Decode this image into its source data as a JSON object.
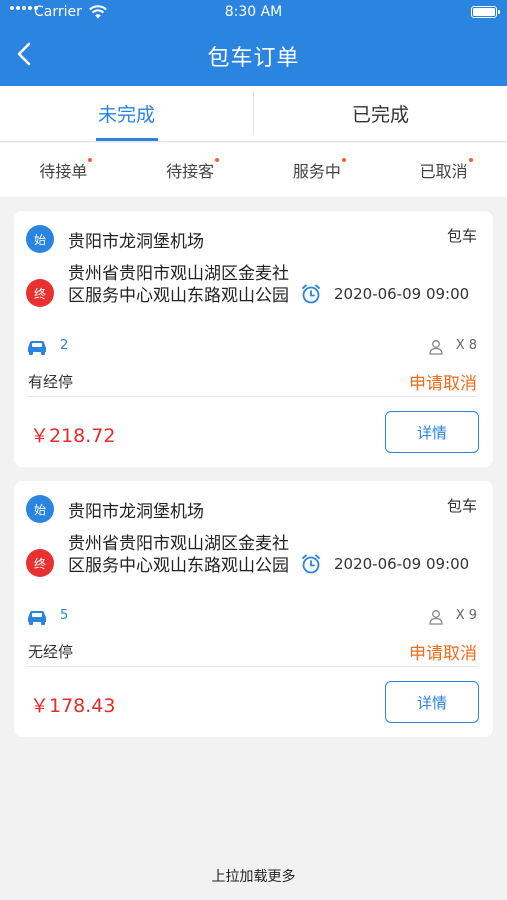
{
  "status_bar": {
    "carrier": "Carrier",
    "time": "8:30 AM"
  },
  "header": {
    "title": "包车订单"
  },
  "tabs": [
    {
      "label": "未完成",
      "active": true
    },
    {
      "label": "已完成",
      "active": false
    }
  ],
  "subtabs": [
    {
      "label": "待接单"
    },
    {
      "label": "待接客"
    },
    {
      "label": "服务中"
    },
    {
      "label": "已取消"
    }
  ],
  "orders": [
    {
      "start_badge": "始",
      "start": "贵阳市龙洞堡机场",
      "type": "包车",
      "end_badge": "终",
      "end": "贵州省贵阳市观山湖区金麦社区服务中心观山东路观山公园",
      "datetime": "2020-06-09 09:00",
      "cars": "2",
      "passengers": "X 8",
      "stops": "有经停",
      "cancel_label": "申请取消",
      "price": "￥218.72",
      "detail_label": "详情"
    },
    {
      "start_badge": "始",
      "start": "贵阳市龙洞堡机场",
      "type": "包车",
      "end_badge": "终",
      "end": "贵州省贵阳市观山湖区金麦社区服务中心观山东路观山公园",
      "datetime": "2020-06-09 09:00",
      "cars": "5",
      "passengers": "X 9",
      "stops": "无经停",
      "cancel_label": "申请取消",
      "price": "￥178.43",
      "detail_label": "详情"
    }
  ],
  "footer": {
    "load_more": "上拉加载更多"
  },
  "colors": {
    "primary": "#2a84e0",
    "danger": "#e83030",
    "orange": "#f26a1b",
    "price": "#e52b2b"
  },
  "icons": [
    "back-arrow-icon",
    "wifi-icon",
    "battery-icon",
    "alarm-clock-icon",
    "car-icon",
    "person-icon"
  ]
}
